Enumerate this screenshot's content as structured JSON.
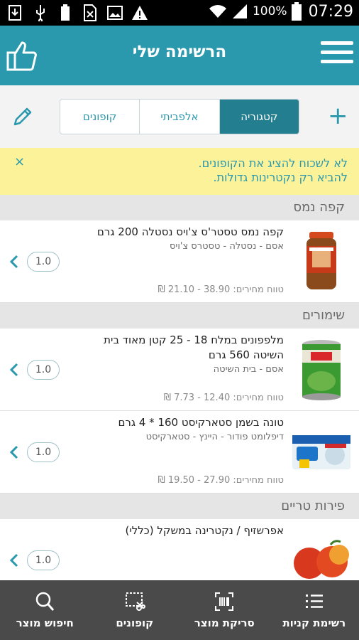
{
  "statusbar": {
    "battery_pct": "100%",
    "time": "07:29"
  },
  "appbar": {
    "title": "הרשימה שלי"
  },
  "tabs": [
    {
      "label": "קופונים",
      "active": false
    },
    {
      "label": "אלפביתי",
      "active": false
    },
    {
      "label": "קטגוריה",
      "active": true
    }
  ],
  "notice": {
    "line1": "לא לשכוח להציג את הקופונים.",
    "line2": "להביא רק נקטרינות גדולות.",
    "close": "×"
  },
  "categories": [
    {
      "name": "קפה נמס"
    },
    {
      "name": "שימורים"
    },
    {
      "name": "פירות טריים"
    }
  ],
  "items": [
    {
      "title": "קפה נמס טסטר'ס צ'ויס נסטלה 200 גרם",
      "subtitle": "אסם - נסטלה - טסטרס צ'ויס",
      "price": "טווח מחירים: 38.90 - 21.10 ₪",
      "qty": "1.0"
    },
    {
      "title": "מלפפונים במלח 18 - 25 קטן מאוד בית השיטה 560 גרם",
      "subtitle": "אסם - בית השיטה",
      "price": "טווח מחירים: 12.40 - 7.73 ₪",
      "qty": "1.0"
    },
    {
      "title": "טונה בשמן סטארקיסט 160 * 4 גרם",
      "subtitle": "דיפלומט פודור - היינץ - סטארקיסט",
      "price": "טווח מחירים: 27.90 - 19.50 ₪",
      "qty": "1.0"
    },
    {
      "title": "אפרשזיף / נקטרינה במשקל (כללי)",
      "subtitle": "",
      "price": "",
      "qty": "1.0"
    }
  ],
  "bottom_nav": [
    {
      "label": "חיפוש מוצר",
      "icon": "search-icon"
    },
    {
      "label": "קופונים",
      "icon": "coupon-scissors-icon"
    },
    {
      "label": "סריקת מוצר",
      "icon": "barcode-scan-icon"
    },
    {
      "label": "רשימת קניות",
      "icon": "list-icon"
    }
  ],
  "colors": {
    "primary": "#2a98ad",
    "tab_active": "#237f8f",
    "notice_bg": "#fbf29a",
    "category_bg": "#e5e5e5",
    "bottom_nav_bg": "#4a4a4a"
  }
}
